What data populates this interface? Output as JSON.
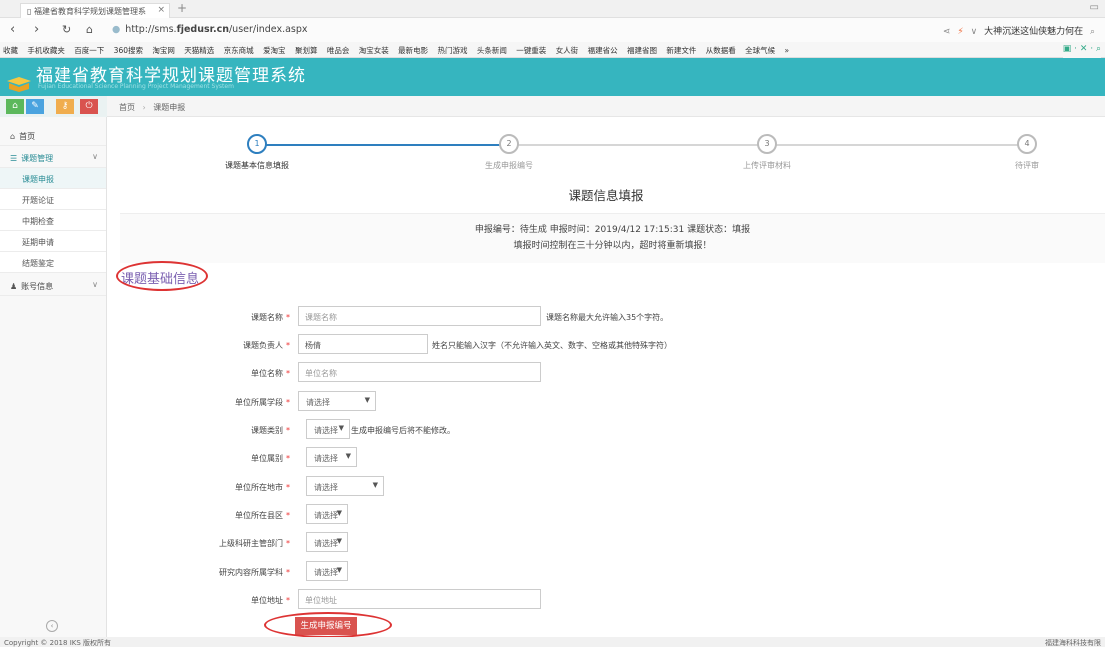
{
  "browser": {
    "tab_title": "福建省教育科学规划课题管理系",
    "url_prefix": "http://sms.",
    "url_domain": "fjedusr.cn",
    "url_path": "/user/index.aspx",
    "search_text": "大神沉迷这仙侠魅力何在",
    "bookmarks": [
      "收藏",
      "手机收藏夹",
      "百度一下",
      "360搜索",
      "淘宝网",
      "天猫精选",
      "京东商城",
      "爱淘宝",
      "聚划算",
      "唯品会",
      "淘宝女装",
      "最新电影",
      "热门游戏",
      "头条新闻",
      "一键重装",
      "女人街",
      "福建省公",
      "福建省图",
      "新建文件",
      "从数据看",
      "全球气候",
      "»"
    ]
  },
  "header": {
    "title": "福建省教育科学规划课题管理系统",
    "subtitle": "Fujian Educational Science Planning Project Management System"
  },
  "breadcrumb": {
    "home": "首页",
    "sep": "›",
    "current": "课题申报"
  },
  "sidebar": {
    "home": "首页",
    "project_manage": "课题管理",
    "subitems": [
      "课题申报",
      "开题论证",
      "中期检查",
      "延期申请",
      "结题鉴定"
    ],
    "account": "账号信息"
  },
  "steps": [
    {
      "num": "1",
      "label": "课题基本信息填报"
    },
    {
      "num": "2",
      "label": "生成申报编号"
    },
    {
      "num": "3",
      "label": "上传评审材料"
    },
    {
      "num": "4",
      "label": "待评审"
    }
  ],
  "form": {
    "title": "课题信息填报",
    "info_line1": "申报编号：待生成 申报时间：2019/4/12 17:15:31 课题状态：填报",
    "info_line2": "填报时间控制在三十分钟以内，超时将重新填报！",
    "section_title": "课题基础信息",
    "required_mark": "*",
    "fields": {
      "name_label": "课题名称",
      "name_placeholder": "课题名称",
      "name_hint": "课题名称最大允许输入35个字符。",
      "leader_label": "课题负责人",
      "leader_value": "杨倩",
      "leader_hint": "姓名只能输入汉字（不允许输入英文、数字、空格或其他特殊字符）",
      "unit_label": "单位名称",
      "unit_placeholder": "单位名称",
      "unit_stage_label": "单位所属学段",
      "unit_stage_value": "请选择",
      "category_label": "课题类别",
      "category_value": "请选择",
      "category_hint": "生成申报编号后将不能修改。",
      "unit_type_label": "单位属别",
      "unit_type_value": "请选择",
      "city_label": "单位所在地市",
      "city_value": "请选择",
      "county_label": "单位所在县区",
      "county_value": "请选择",
      "dept_label": "上级科研主管部门",
      "dept_value": "请选择",
      "subject_label": "研究内容所属学科",
      "subject_value": "请选择",
      "address_label": "单位地址",
      "address_placeholder": "单位地址"
    },
    "generate_button": "生成申报编号"
  },
  "footer": {
    "copyright": "Copyright © 2018 IKS 版权所有",
    "right": "福建海科科技有限"
  }
}
